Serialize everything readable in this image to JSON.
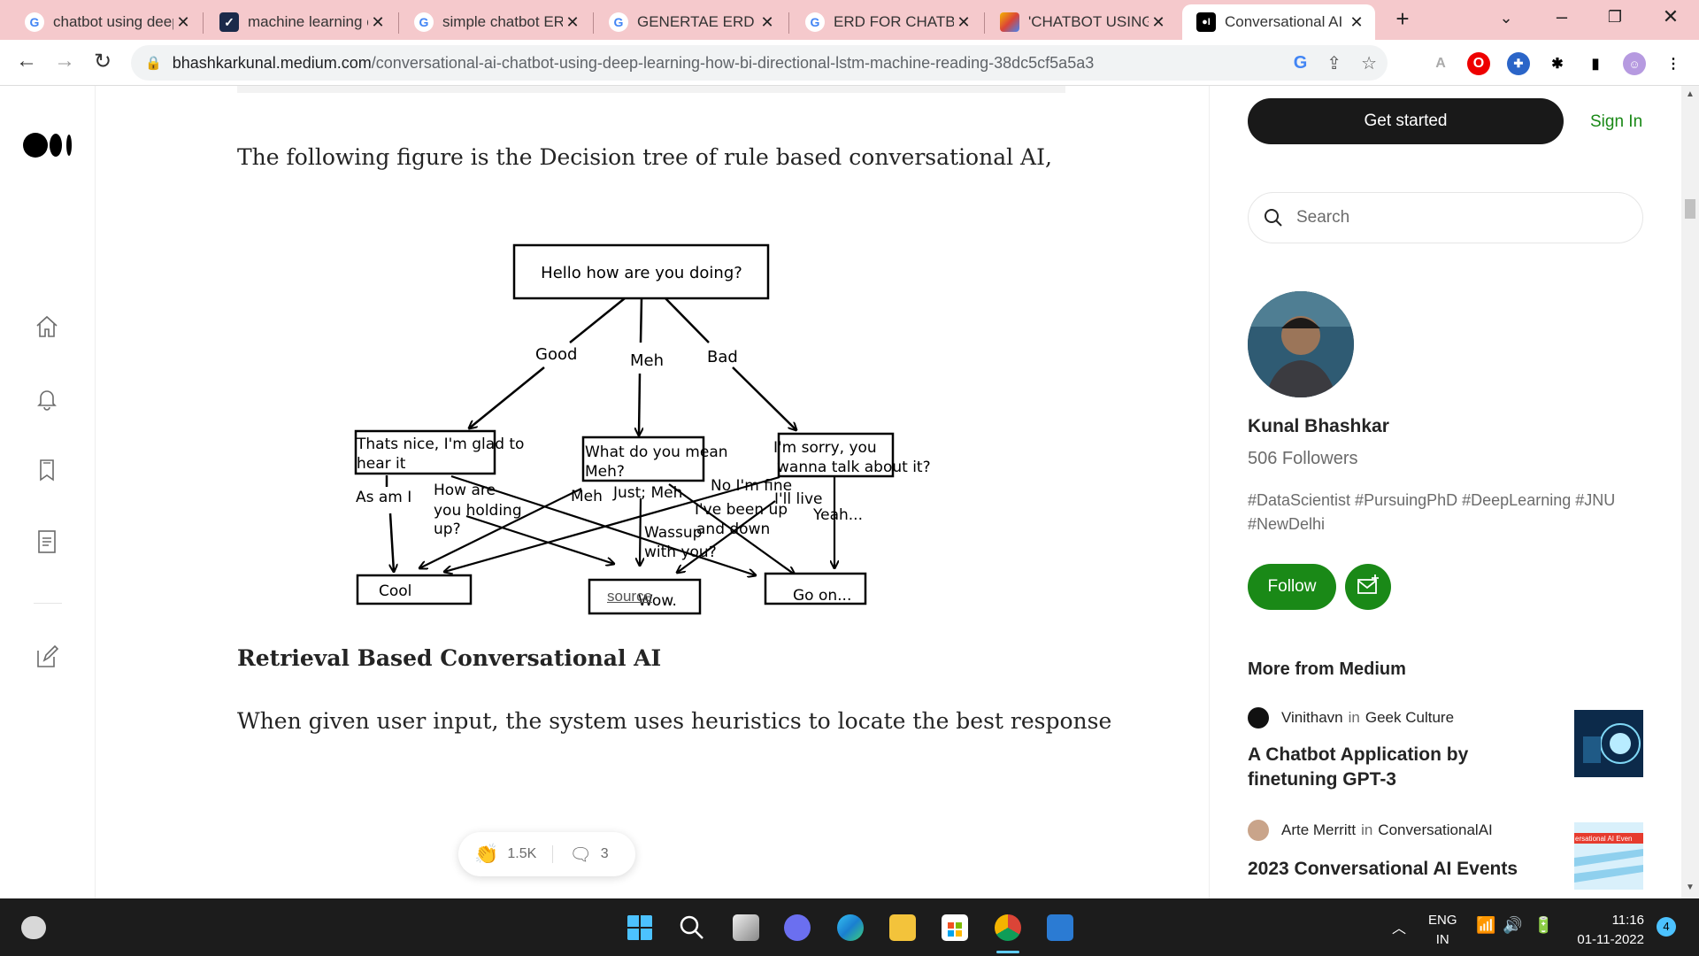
{
  "browser": {
    "tabs": [
      {
        "title": "chatbot using deep",
        "favicon": "google-g",
        "active": false
      },
      {
        "title": "machine learning c",
        "favicon": "shield",
        "active": false
      },
      {
        "title": "simple chatbot ER",
        "favicon": "google-g",
        "active": false
      },
      {
        "title": "GENERTAE ERD DIA",
        "favicon": "google-g",
        "active": false
      },
      {
        "title": "ERD FOR CHATBOT",
        "favicon": "google-g",
        "active": false
      },
      {
        "title": "'CHATBOT USING D",
        "favicon": "colorful",
        "active": false
      },
      {
        "title": "Conversational AI",
        "favicon": "medium",
        "active": true
      }
    ],
    "url_host": "bhashkarkunal.medium.com",
    "url_path": "/conversational-ai-chatbot-using-deep-learning-how-bi-directional-lstm-machine-reading-38dc5cf5a5a3"
  },
  "article": {
    "intro": "The following figure is the Decision tree of rule based conversational AI,",
    "source_link": "source",
    "heading": "Retrieval Based Conversational AI",
    "body_start": "When given user input, the system uses heuristics to locate the best response",
    "claps": "1.5K",
    "responses": "3"
  },
  "diagram": {
    "root": "Hello how are you doing?",
    "branch_labels": [
      "Good",
      "Meh",
      "Bad"
    ],
    "mid_nodes": [
      [
        "Thats nice, I'm glad to",
        "hear it"
      ],
      [
        "What do you mean",
        "Meh?"
      ],
      [
        "I'm sorry, you",
        "wanna talk about it?"
      ]
    ],
    "edge_labels": {
      "as_am_i": "As am I",
      "how_are": [
        "How are",
        "you holding",
        "up?"
      ],
      "meh": "Meh",
      "just_meh": "Just; Meh",
      "no_fine": "No I'm fine",
      "ill_live": "I'll live",
      "ive_been": [
        "I've been up",
        "and down"
      ],
      "wassup": [
        "Wassup",
        "with you?"
      ],
      "yeah": "Yeah..."
    },
    "leaf_nodes": [
      "Cool",
      "Wow.",
      "Go on..."
    ]
  },
  "sidebar": {
    "get_started": "Get started",
    "sign_in": "Sign In",
    "search_placeholder": "Search",
    "author_name": "Kunal Bhashkar",
    "followers": "506 Followers",
    "bio": "#DataScientist #PursuingPhD #DeepLearning #JNU #NewDelhi",
    "follow": "Follow",
    "more_from": "More from Medium",
    "recommendations": [
      {
        "author": "Vinithavn",
        "in": "in",
        "publication": "Geek Culture",
        "title": "A Chatbot Application by finetuning GPT-3"
      },
      {
        "author": "Arte Merritt",
        "in": "in",
        "publication": "ConversationalAI",
        "title": "2023 Conversational AI Events",
        "thumb_text": "ersational AI Even"
      }
    ]
  },
  "taskbar": {
    "lang": "ENG",
    "region": "IN",
    "time": "11:16",
    "date": "01-11-2022",
    "notifications": "4"
  },
  "colors": {
    "medium_green": "#1a8917",
    "tab_strip": "#f5c9cc",
    "dark": "#191919"
  }
}
